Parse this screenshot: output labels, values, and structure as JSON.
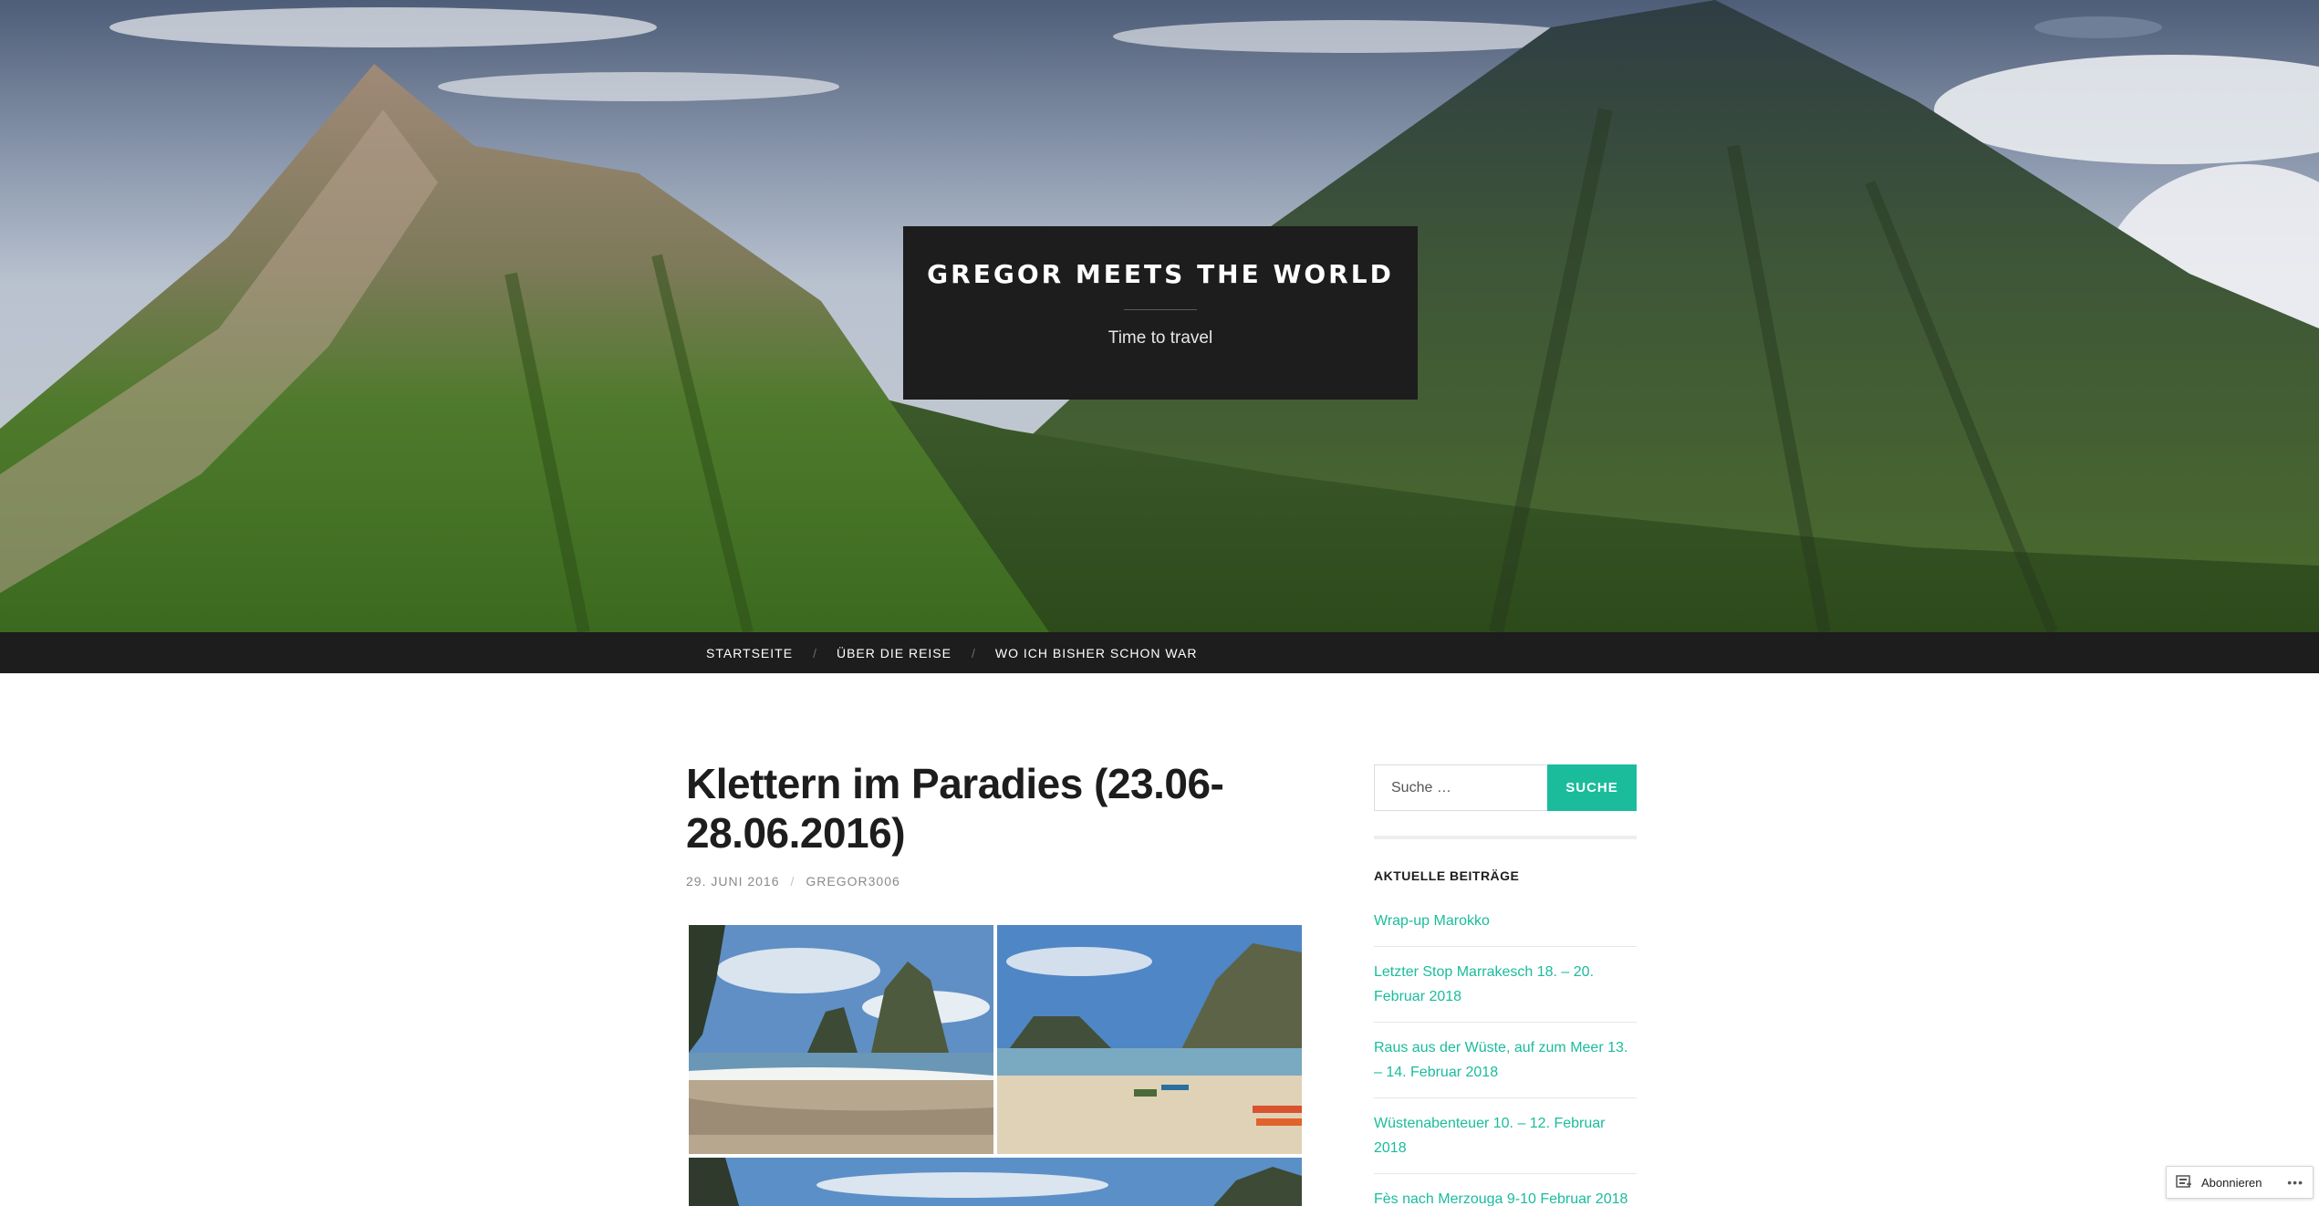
{
  "header": {
    "site_title": "GREGOR MEETS THE WORLD",
    "tagline": "Time to travel",
    "hero_image": "volcano-mountains-photo"
  },
  "nav": {
    "items": [
      {
        "label": "STARTSEITE"
      },
      {
        "label": "ÜBER DIE REISE"
      },
      {
        "label": "WO ICH BISHER SCHON WAR"
      }
    ],
    "separator": "/"
  },
  "post": {
    "title": "Klettern im Paradies (23.06-28.06.2016)",
    "date": "29. JUNI 2016",
    "meta_separator": "/",
    "author": "GREGOR3006",
    "gallery": [
      {
        "name": "beach-rock-photo"
      },
      {
        "name": "beach-kayaks-photo"
      },
      {
        "name": "cliff-panorama-photo"
      }
    ]
  },
  "sidebar": {
    "search": {
      "placeholder": "Suche …",
      "button_label": "SUCHE"
    },
    "recent_posts": {
      "title": "AKTUELLE BEITRÄGE",
      "items": [
        {
          "label": "Wrap-up Marokko"
        },
        {
          "label": "Letzter Stop Marrakesch 18. – 20. Februar 2018"
        },
        {
          "label": "Raus aus der Wüste, auf zum Meer 13. – 14. Februar 2018"
        },
        {
          "label": "Wüstenabenteuer 10. – 12. Februar 2018"
        },
        {
          "label": "Fès nach Merzouga 9-10 Februar 2018"
        }
      ]
    }
  },
  "follow": {
    "label": "Abonnieren",
    "more": "•••"
  },
  "colors": {
    "accent": "#1abc9c",
    "dark": "#1d1d1d",
    "meta": "#8a8a8a"
  }
}
